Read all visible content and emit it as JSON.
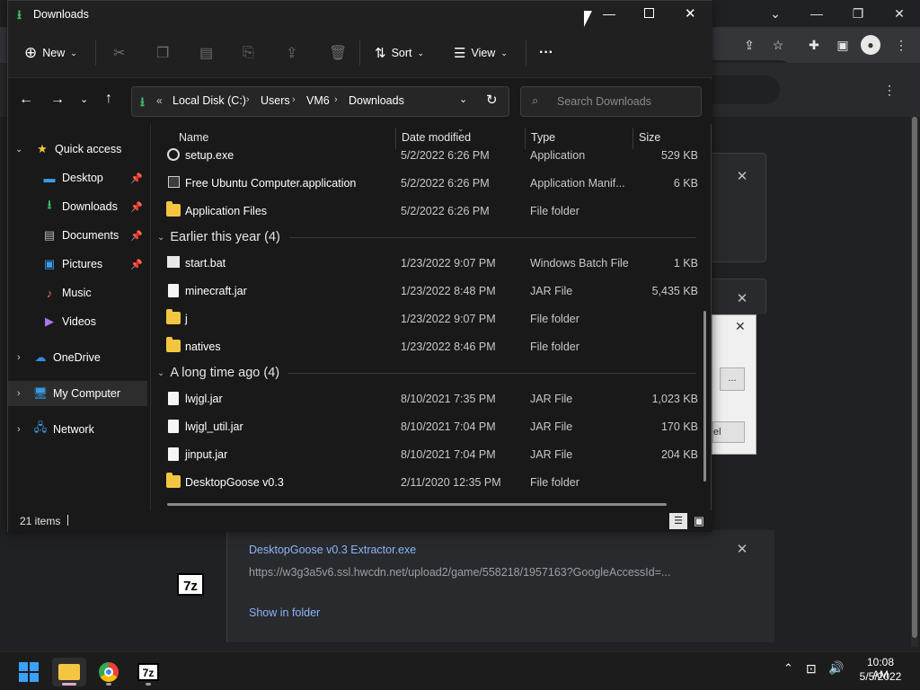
{
  "chrome": {
    "menu_icon": "kebab-icon",
    "downloads": [
      {
        "filename": "DesktopGoose v0.3 Extractor.exe",
        "url": "https://w3g3a5v6.ssl.hwcdn.net/upload2/game/558218/1957163?GoogleAccessId=...",
        "action": "Show in folder",
        "icon_text": "7z"
      }
    ],
    "dialog_button": "...",
    "dialog_button2": "el"
  },
  "explorer": {
    "title": "Downloads",
    "toolbar": {
      "new": "New",
      "sort": "Sort",
      "view": "View",
      "more": "···"
    },
    "breadcrumb": [
      "Local Disk (C:)",
      "Users",
      "VM6",
      "Downloads"
    ],
    "breadcrumb_prefix": "«",
    "search_placeholder": "Search Downloads",
    "nav": {
      "quick_access": "Quick access",
      "items": [
        "Desktop",
        "Downloads",
        "Documents",
        "Pictures",
        "Music",
        "Videos"
      ],
      "onedrive": "OneDrive",
      "mycomputer": "My Computer",
      "network": "Network"
    },
    "columns": {
      "name": "Name",
      "date": "Date modified",
      "type": "Type",
      "size": "Size"
    },
    "groups": [
      {
        "label": "",
        "files": [
          {
            "name": "setup.exe",
            "date": "5/2/2022 6:26 PM",
            "type": "Application",
            "size": "529 KB",
            "icon": "setup"
          },
          {
            "name": "Free Ubuntu Computer.application",
            "date": "5/2/2022 6:26 PM",
            "type": "Application Manif...",
            "size": "6 KB",
            "icon": "app"
          },
          {
            "name": "Application Files",
            "date": "5/2/2022 6:26 PM",
            "type": "File folder",
            "size": "",
            "icon": "folder"
          }
        ]
      },
      {
        "label": "Earlier this year (4)",
        "files": [
          {
            "name": "start.bat",
            "date": "1/23/2022 9:07 PM",
            "type": "Windows Batch File",
            "size": "1 KB",
            "icon": "bat"
          },
          {
            "name": "minecraft.jar",
            "date": "1/23/2022 8:48 PM",
            "type": "JAR File",
            "size": "5,435 KB",
            "icon": "doc"
          },
          {
            "name": "j",
            "date": "1/23/2022 9:07 PM",
            "type": "File folder",
            "size": "",
            "icon": "folder"
          },
          {
            "name": "natives",
            "date": "1/23/2022 8:46 PM",
            "type": "File folder",
            "size": "",
            "icon": "folder"
          }
        ]
      },
      {
        "label": "A long time ago (4)",
        "files": [
          {
            "name": "lwjgl.jar",
            "date": "8/10/2021 7:35 PM",
            "type": "JAR File",
            "size": "1,023 KB",
            "icon": "doc"
          },
          {
            "name": "lwjgl_util.jar",
            "date": "8/10/2021 7:04 PM",
            "type": "JAR File",
            "size": "170 KB",
            "icon": "doc"
          },
          {
            "name": "jinput.jar",
            "date": "8/10/2021 7:04 PM",
            "type": "JAR File",
            "size": "204 KB",
            "icon": "doc"
          },
          {
            "name": "DesktopGoose v0.3",
            "date": "2/11/2020 12:35 PM",
            "type": "File folder",
            "size": "",
            "icon": "folder"
          }
        ]
      }
    ],
    "status": "21 items"
  },
  "taskbar": {
    "time": "10:08 AM",
    "date": "5/5/2022",
    "app_7z": "7z"
  },
  "colors": {
    "accent": "#0078d4",
    "folder": "#f4c542",
    "link": "#8ab4f8",
    "download_green": "#3cc16b"
  }
}
